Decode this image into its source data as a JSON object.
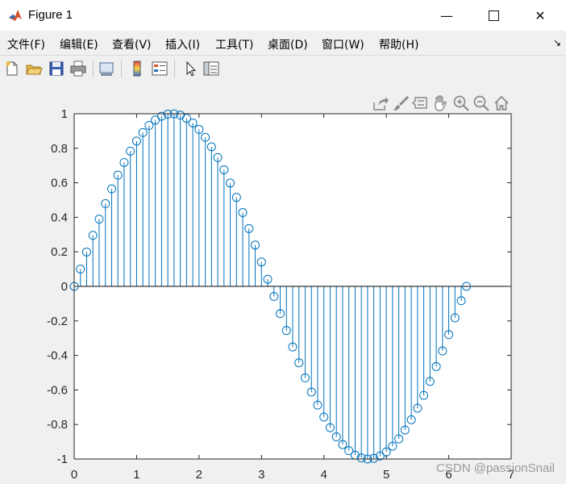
{
  "window": {
    "title": "Figure 1"
  },
  "menu": [
    {
      "label": "文件(F)"
    },
    {
      "label": "编辑(E)"
    },
    {
      "label": "查看(V)"
    },
    {
      "label": "插入(I)"
    },
    {
      "label": "工具(T)"
    },
    {
      "label": "桌面(D)"
    },
    {
      "label": "窗口(W)"
    },
    {
      "label": "帮助(H)"
    }
  ],
  "toolbar_icons": [
    "new-figure-icon",
    "open-file-icon",
    "save-icon",
    "print-icon",
    "link-plot-icon",
    "colorbar-icon",
    "legend-icon",
    "select-arrow-icon",
    "property-inspector-icon"
  ],
  "axes_toolbar_icons": [
    "export-icon",
    "brush-icon",
    "data-tips-icon",
    "pan-icon",
    "zoom-in-icon",
    "zoom-out-icon",
    "home-icon"
  ],
  "watermark": "CSDN @passionSnail",
  "colors": {
    "series": "#0072bd",
    "baseline": "#000000",
    "axes_bg": "#ffffff"
  },
  "chart_data": {
    "type": "stem",
    "function": "sin(x)",
    "x_step": 0.1,
    "x_start": 0,
    "x_end": 6.2832,
    "marker": "circle",
    "baseline": 0,
    "xlim": [
      0,
      7
    ],
    "ylim": [
      -1,
      1
    ],
    "xticks": [
      "0",
      "1",
      "2",
      "3",
      "4",
      "5",
      "6",
      "7"
    ],
    "yticks": [
      "1",
      "0.8",
      "0.6",
      "0.4",
      "0.2",
      "0",
      "-0.2",
      "-0.4",
      "-0.6",
      "-0.8",
      "-1"
    ],
    "grid": false
  }
}
